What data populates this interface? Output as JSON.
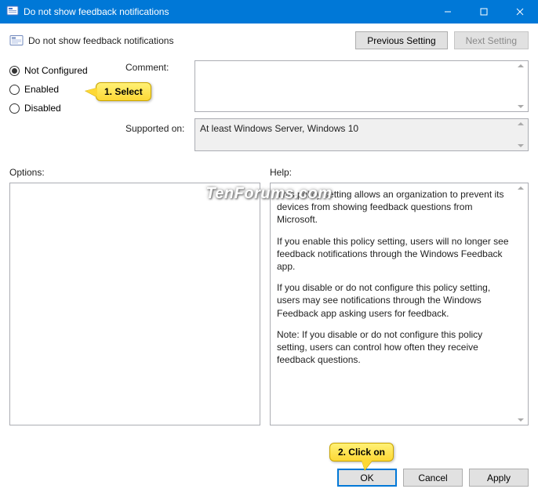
{
  "window": {
    "title": "Do not show feedback notifications"
  },
  "header": {
    "title": "Do not show feedback notifications",
    "prev_label": "Previous Setting",
    "next_label": "Next Setting"
  },
  "radios": {
    "not_configured": "Not Configured",
    "enabled": "Enabled",
    "disabled": "Disabled",
    "selected": "not_configured"
  },
  "labels": {
    "comment": "Comment:",
    "supported": "Supported on:",
    "options": "Options:",
    "help": "Help:"
  },
  "supported": {
    "text": "At least Windows Server, Windows 10"
  },
  "help": {
    "p1": "This policy setting allows an organization to prevent its devices from showing feedback questions from Microsoft.",
    "p2": "If you enable this policy setting, users will no longer see feedback notifications through the Windows Feedback app.",
    "p3": "If you disable or do not configure this policy setting, users may see notifications through the Windows Feedback app asking users for feedback.",
    "p4": "Note: If you disable or do not configure this policy setting, users can control how often they receive feedback questions."
  },
  "footer": {
    "ok": "OK",
    "cancel": "Cancel",
    "apply": "Apply"
  },
  "annotations": {
    "callout1": "1. Select",
    "callout2": "2. Click on",
    "watermark": "TenForums.com"
  }
}
